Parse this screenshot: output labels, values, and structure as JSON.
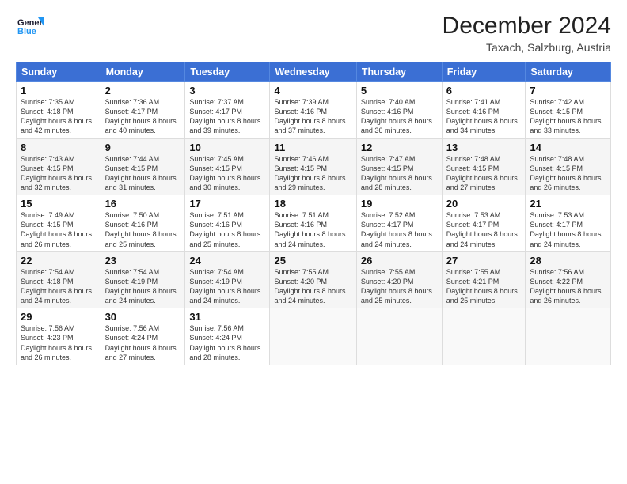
{
  "header": {
    "logo_line1": "General",
    "logo_line2": "Blue",
    "month_year": "December 2024",
    "location": "Taxach, Salzburg, Austria"
  },
  "weekdays": [
    "Sunday",
    "Monday",
    "Tuesday",
    "Wednesday",
    "Thursday",
    "Friday",
    "Saturday"
  ],
  "weeks": [
    [
      {
        "day": "1",
        "sunrise": "7:35 AM",
        "sunset": "4:18 PM",
        "daylight": "8 hours and 42 minutes."
      },
      {
        "day": "2",
        "sunrise": "7:36 AM",
        "sunset": "4:17 PM",
        "daylight": "8 hours and 40 minutes."
      },
      {
        "day": "3",
        "sunrise": "7:37 AM",
        "sunset": "4:17 PM",
        "daylight": "8 hours and 39 minutes."
      },
      {
        "day": "4",
        "sunrise": "7:39 AM",
        "sunset": "4:16 PM",
        "daylight": "8 hours and 37 minutes."
      },
      {
        "day": "5",
        "sunrise": "7:40 AM",
        "sunset": "4:16 PM",
        "daylight": "8 hours and 36 minutes."
      },
      {
        "day": "6",
        "sunrise": "7:41 AM",
        "sunset": "4:16 PM",
        "daylight": "8 hours and 34 minutes."
      },
      {
        "day": "7",
        "sunrise": "7:42 AM",
        "sunset": "4:15 PM",
        "daylight": "8 hours and 33 minutes."
      }
    ],
    [
      {
        "day": "8",
        "sunrise": "7:43 AM",
        "sunset": "4:15 PM",
        "daylight": "8 hours and 32 minutes."
      },
      {
        "day": "9",
        "sunrise": "7:44 AM",
        "sunset": "4:15 PM",
        "daylight": "8 hours and 31 minutes."
      },
      {
        "day": "10",
        "sunrise": "7:45 AM",
        "sunset": "4:15 PM",
        "daylight": "8 hours and 30 minutes."
      },
      {
        "day": "11",
        "sunrise": "7:46 AM",
        "sunset": "4:15 PM",
        "daylight": "8 hours and 29 minutes."
      },
      {
        "day": "12",
        "sunrise": "7:47 AM",
        "sunset": "4:15 PM",
        "daylight": "8 hours and 28 minutes."
      },
      {
        "day": "13",
        "sunrise": "7:48 AM",
        "sunset": "4:15 PM",
        "daylight": "8 hours and 27 minutes."
      },
      {
        "day": "14",
        "sunrise": "7:48 AM",
        "sunset": "4:15 PM",
        "daylight": "8 hours and 26 minutes."
      }
    ],
    [
      {
        "day": "15",
        "sunrise": "7:49 AM",
        "sunset": "4:15 PM",
        "daylight": "8 hours and 26 minutes."
      },
      {
        "day": "16",
        "sunrise": "7:50 AM",
        "sunset": "4:16 PM",
        "daylight": "8 hours and 25 minutes."
      },
      {
        "day": "17",
        "sunrise": "7:51 AM",
        "sunset": "4:16 PM",
        "daylight": "8 hours and 25 minutes."
      },
      {
        "day": "18",
        "sunrise": "7:51 AM",
        "sunset": "4:16 PM",
        "daylight": "8 hours and 24 minutes."
      },
      {
        "day": "19",
        "sunrise": "7:52 AM",
        "sunset": "4:17 PM",
        "daylight": "8 hours and 24 minutes."
      },
      {
        "day": "20",
        "sunrise": "7:53 AM",
        "sunset": "4:17 PM",
        "daylight": "8 hours and 24 minutes."
      },
      {
        "day": "21",
        "sunrise": "7:53 AM",
        "sunset": "4:17 PM",
        "daylight": "8 hours and 24 minutes."
      }
    ],
    [
      {
        "day": "22",
        "sunrise": "7:54 AM",
        "sunset": "4:18 PM",
        "daylight": "8 hours and 24 minutes."
      },
      {
        "day": "23",
        "sunrise": "7:54 AM",
        "sunset": "4:19 PM",
        "daylight": "8 hours and 24 minutes."
      },
      {
        "day": "24",
        "sunrise": "7:54 AM",
        "sunset": "4:19 PM",
        "daylight": "8 hours and 24 minutes."
      },
      {
        "day": "25",
        "sunrise": "7:55 AM",
        "sunset": "4:20 PM",
        "daylight": "8 hours and 24 minutes."
      },
      {
        "day": "26",
        "sunrise": "7:55 AM",
        "sunset": "4:20 PM",
        "daylight": "8 hours and 25 minutes."
      },
      {
        "day": "27",
        "sunrise": "7:55 AM",
        "sunset": "4:21 PM",
        "daylight": "8 hours and 25 minutes."
      },
      {
        "day": "28",
        "sunrise": "7:56 AM",
        "sunset": "4:22 PM",
        "daylight": "8 hours and 26 minutes."
      }
    ],
    [
      {
        "day": "29",
        "sunrise": "7:56 AM",
        "sunset": "4:23 PM",
        "daylight": "8 hours and 26 minutes."
      },
      {
        "day": "30",
        "sunrise": "7:56 AM",
        "sunset": "4:24 PM",
        "daylight": "8 hours and 27 minutes."
      },
      {
        "day": "31",
        "sunrise": "7:56 AM",
        "sunset": "4:24 PM",
        "daylight": "8 hours and 28 minutes."
      },
      null,
      null,
      null,
      null
    ]
  ]
}
